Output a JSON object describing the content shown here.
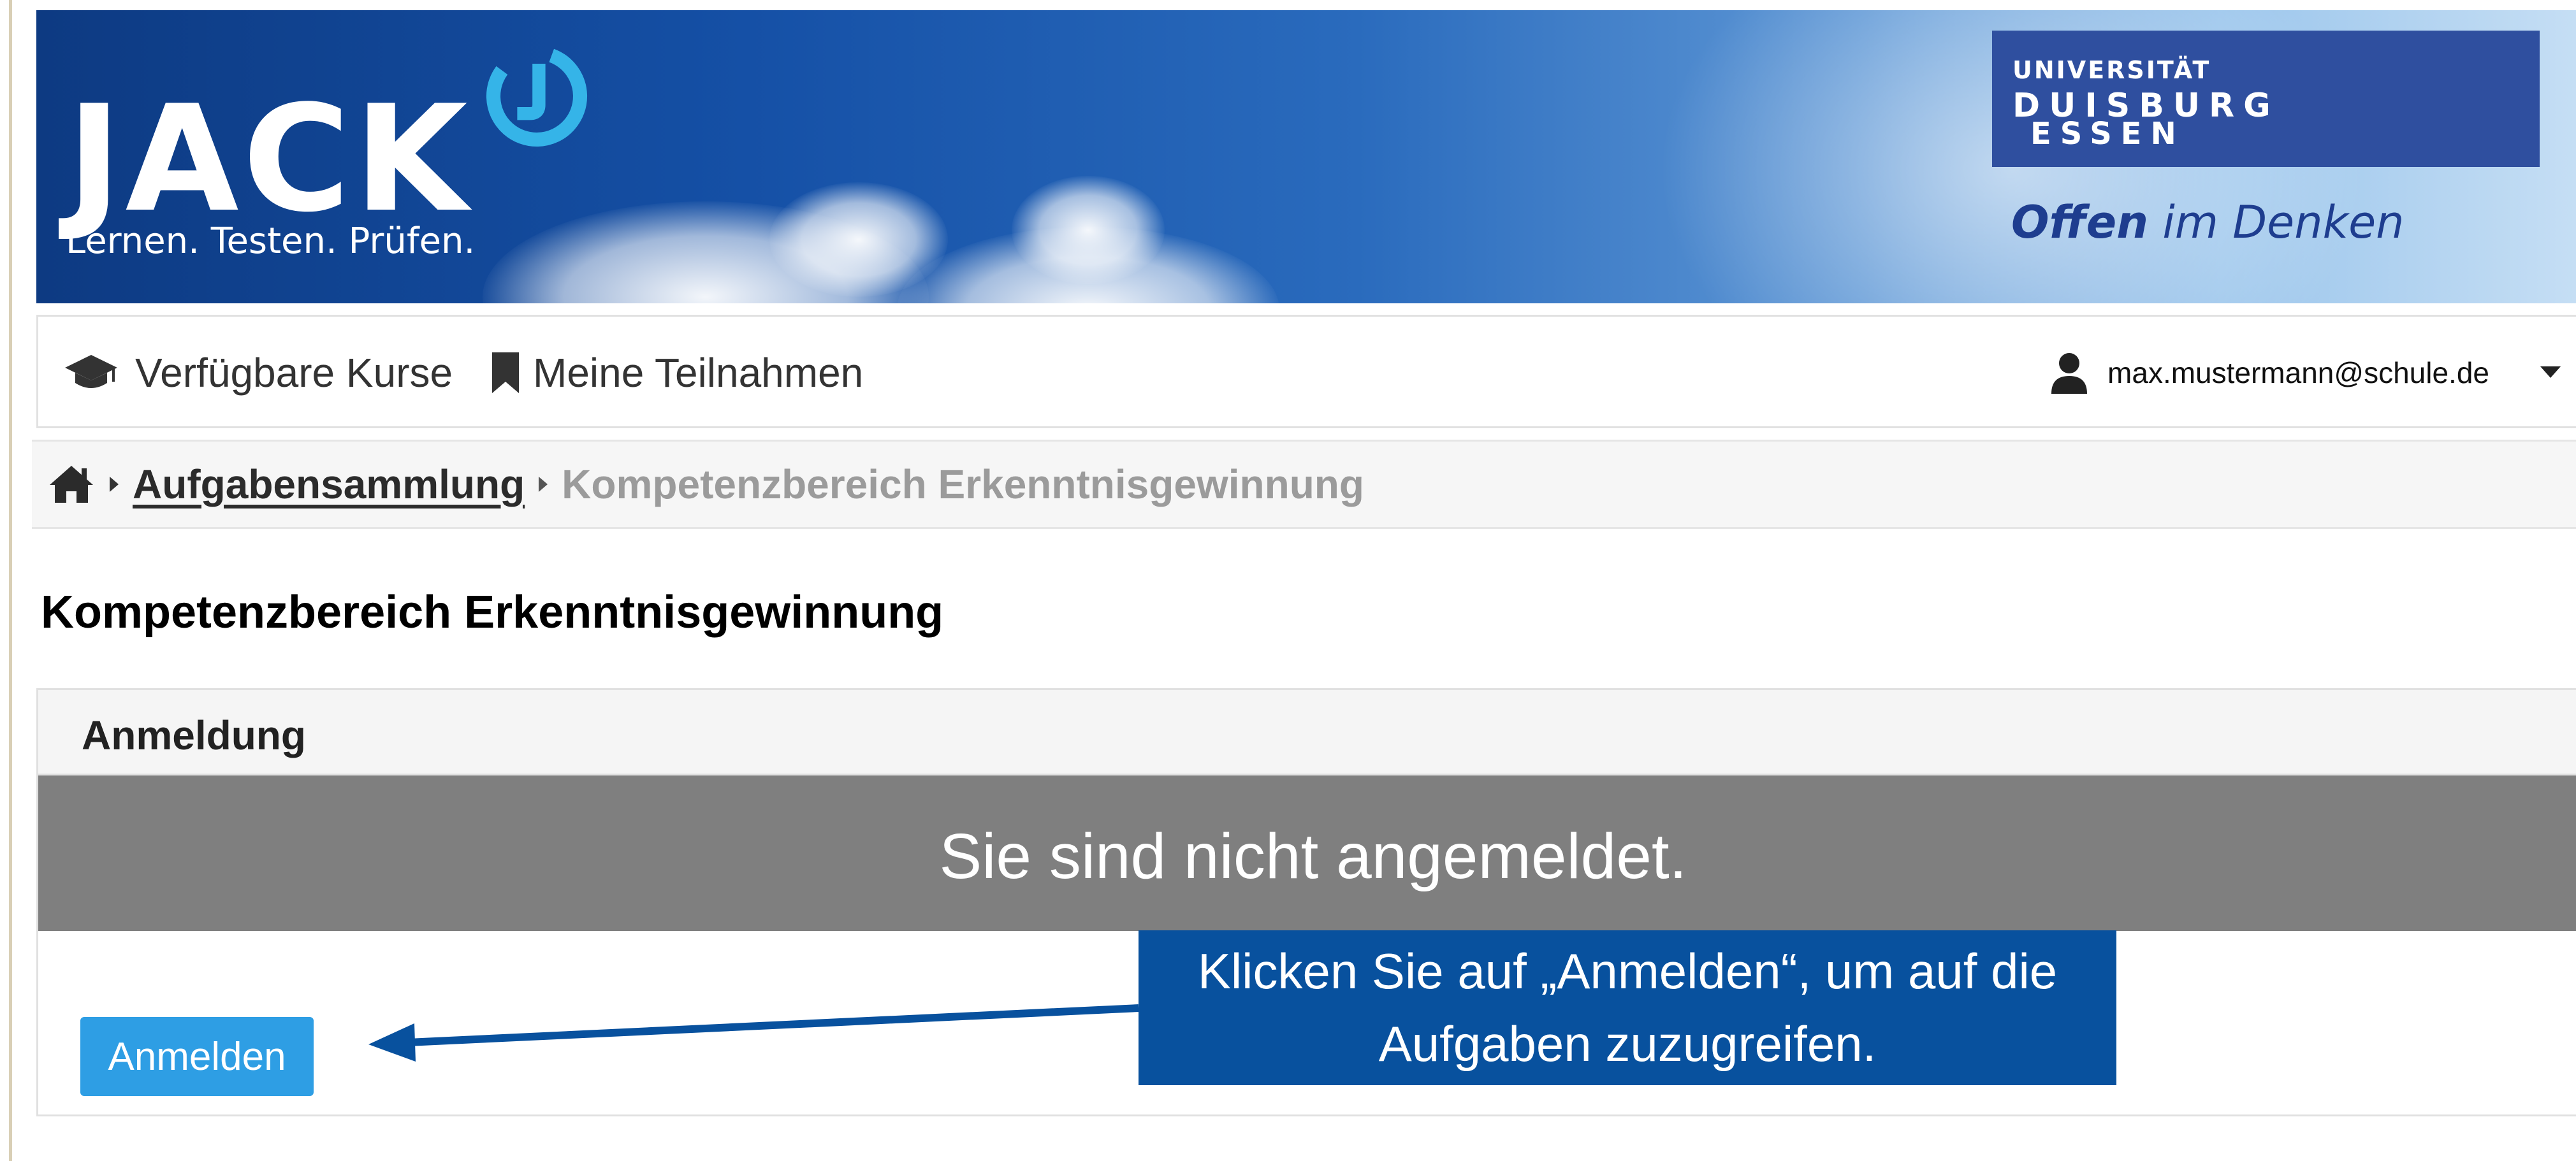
{
  "banner": {
    "logo_text": "JACK",
    "tagline": "Lernen. Testen. Prüfen.",
    "university": {
      "line1": "UNIVERSITÄT",
      "line2": "DUISBURG",
      "line3": "ESSEN",
      "slogan_bold": "Offen",
      "slogan_rest": " im Denken"
    }
  },
  "nav": {
    "courses_label": "Verfügbare Kurse",
    "participations_label": "Meine Teilnahmen",
    "user_email": "max.mustermann@schule.de"
  },
  "breadcrumb": {
    "collection": "Aufgabensammlung",
    "current": "Kompetenzbereich Erkenntnisgewinnung"
  },
  "page": {
    "title": "Kompetenzbereich Erkenntnisgewinnung"
  },
  "panel": {
    "heading": "Anmeldung",
    "alert": "Sie sind nicht angemeldet.",
    "login_button": "Anmelden"
  },
  "callout": {
    "text": "Klicken Sie auf „Anmelden“, um auf die Aufgaben zuzugreifen."
  },
  "colors": {
    "callout_bg": "#08519e",
    "button_bg": "#2e9ee4",
    "alert_bg": "#7f7f7f",
    "jack_accent": "#35b4e8",
    "ude_blue": "#2f4f9f"
  }
}
